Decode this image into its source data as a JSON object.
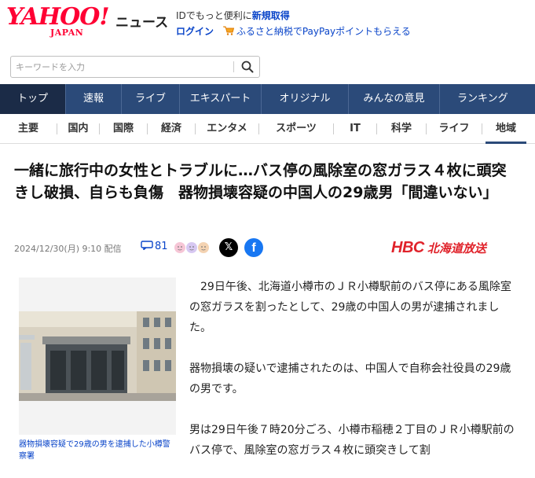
{
  "header": {
    "logo_main": "YAHOO!",
    "logo_sub": "JAPAN",
    "service": "ニュース",
    "promo_line1_prefix": "IDでもっと便利に",
    "promo_line1_link": "新規取得",
    "login": "ログイン",
    "promo_line2": "ふるさと納税でPayPayポイントもらえる"
  },
  "search": {
    "placeholder": "キーワードを入力",
    "value": ""
  },
  "nav_primary": [
    "トップ",
    "速報",
    "ライブ",
    "エキスパート",
    "オリジナル",
    "みんなの意見",
    "ランキング"
  ],
  "nav_secondary": [
    "主要",
    "国内",
    "国際",
    "経済",
    "エンタメ",
    "スポーツ",
    "IT",
    "科学",
    "ライフ",
    "地域"
  ],
  "nav_secondary_active": "地域",
  "article": {
    "headline": "一緒に旅行中の女性とトラブルに…バス停の風除室の窓ガラス４枚に頭突きし破損、自らも負傷　器物損壊容疑の中国人の29歳男「間違いない」",
    "datetime": "2024/12/30(月) 9:10 配信",
    "comment_count": "81",
    "source_logo": "HBC",
    "source_name": "北海道放送",
    "photo_caption": "器物損壊容疑で29歳の男を逮捕した小樽警察署",
    "paragraphs": [
      "29日午後、北海道小樽市のＪＲ小樽駅前のバス停にある風除室の窓ガラスを割ったとして、29歳の中国人の男が逮捕されました。",
      "器物損壊の疑いで逮捕されたのは、中国人で自称会社役員の29歳の男です。",
      "男は29日午後７時20分ごろ、小樽市稲穂２丁目のＪＲ小樽駅前のバス停で、風除室の窓ガラス４枚に頭突きして割"
    ]
  },
  "colors": {
    "brand_red": "#ff0033",
    "nav_bg": "#2b4a79",
    "nav_active": "#1b2b47",
    "link_blue": "#0a45c9",
    "hbc_red": "#e0222a"
  },
  "icons": [
    "search-icon",
    "cart-icon",
    "comment-icon",
    "reaction-faces-icon",
    "x-share-icon",
    "facebook-share-icon"
  ]
}
